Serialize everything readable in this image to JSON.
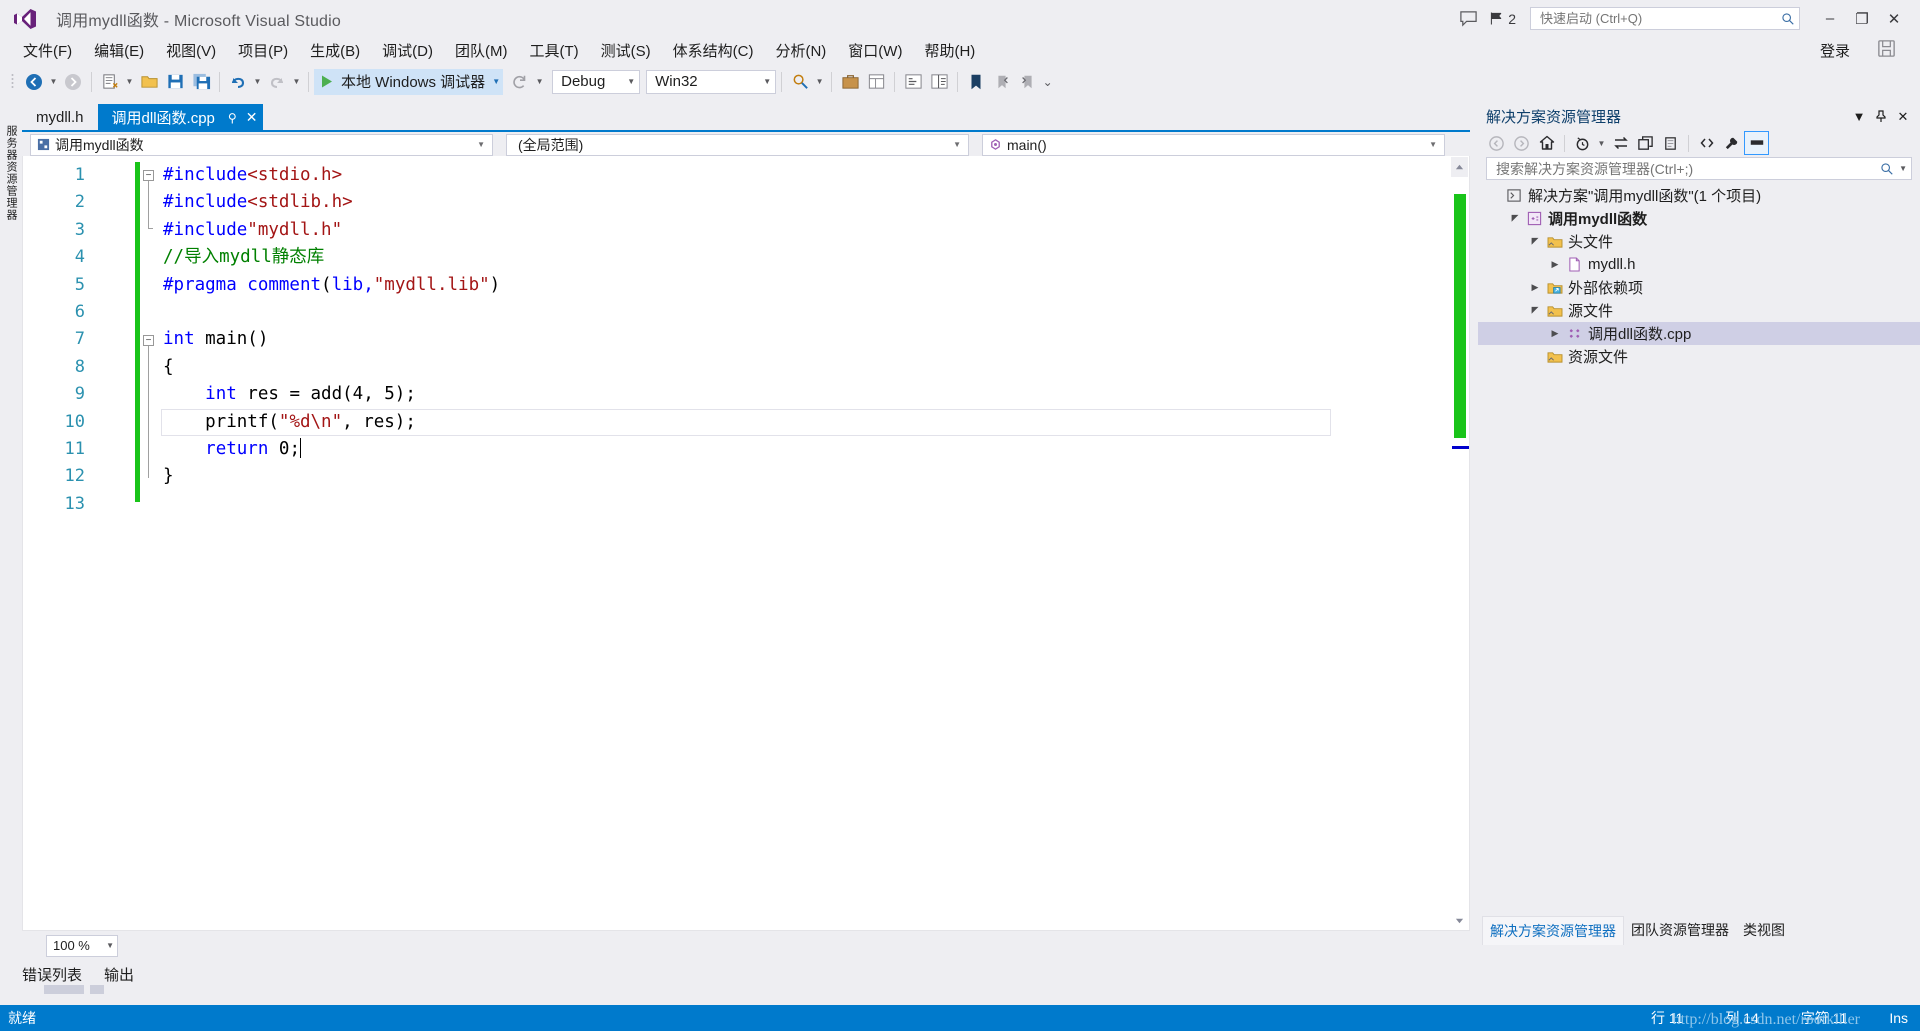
{
  "window": {
    "title": "调用mydll函数 - Microsoft Visual Studio",
    "logo_icon": "visual-studio-logo",
    "minimize_label": "–",
    "maximize_label": "❐",
    "close_label": "✕",
    "signin_label": "登录",
    "notification_count": "2",
    "feedback_icon": "feedback-icon",
    "notification_icon": "notification-flag-icon",
    "save_cloud_icon": "save-cloud-icon"
  },
  "quick_launch": {
    "placeholder": "快速启动 (Ctrl+Q)",
    "value": "",
    "icon": "search-icon"
  },
  "menu": {
    "items": [
      {
        "label": "文件(F)"
      },
      {
        "label": "编辑(E)"
      },
      {
        "label": "视图(V)"
      },
      {
        "label": "项目(P)"
      },
      {
        "label": "生成(B)"
      },
      {
        "label": "调试(D)"
      },
      {
        "label": "团队(M)"
      },
      {
        "label": "工具(T)"
      },
      {
        "label": "测试(S)"
      },
      {
        "label": "体系结构(C)"
      },
      {
        "label": "分析(N)"
      },
      {
        "label": "窗口(W)"
      },
      {
        "label": "帮助(H)"
      }
    ]
  },
  "toolbar": {
    "back_icon": "navigate-back-icon",
    "forward_icon": "navigate-forward-icon",
    "new_project_icon": "new-project-icon",
    "open_file_icon": "open-file-icon",
    "save_icon": "save-icon",
    "save_all_icon": "save-all-icon",
    "undo_icon": "undo-icon",
    "redo_icon": "redo-icon",
    "start_label": "本地 Windows 调试器",
    "start_icon": "play-icon",
    "refresh_icon": "refresh-icon",
    "config_value": "Debug",
    "platform_value": "Win32",
    "find_icon": "find-in-files-icon",
    "step_icons": [
      "toolbox-icon",
      "properties-icon",
      "class-view-icon",
      "object-browser-icon",
      "bookmark-icon",
      "prev-bookmark-icon",
      "next-bookmark-icon"
    ]
  },
  "left_rail": {
    "label": "服务器资源管理器"
  },
  "editor": {
    "tabs": [
      {
        "label": "mydll.h",
        "active": false
      },
      {
        "label": "调用dll函数.cpp",
        "active": true,
        "pin_icon": "pin-icon",
        "close_icon": "close-icon"
      }
    ],
    "navbar": {
      "project_icon": "project-icon",
      "project": "调用mydll函数",
      "scope": "(全局范围)",
      "member_icon": "method-icon",
      "member": "main()"
    },
    "zoom_level": "100 %",
    "line_numbers": [
      "1",
      "2",
      "3",
      "4",
      "5",
      "6",
      "7",
      "8",
      "9",
      "10",
      "11",
      "12",
      "13"
    ],
    "code_lines": [
      {
        "n": 1,
        "tokens": [
          {
            "t": "#include",
            "c": "pp"
          },
          {
            "t": "<stdio.h>",
            "c": "str"
          }
        ]
      },
      {
        "n": 2,
        "tokens": [
          {
            "t": "#include",
            "c": "pp"
          },
          {
            "t": "<stdlib.h>",
            "c": "str"
          }
        ]
      },
      {
        "n": 3,
        "tokens": [
          {
            "t": "#include",
            "c": "pp"
          },
          {
            "t": "\"mydll.h\"",
            "c": "str"
          }
        ]
      },
      {
        "n": 4,
        "tokens": [
          {
            "t": "//导入mydll静态库",
            "c": "cmt"
          }
        ]
      },
      {
        "n": 5,
        "tokens": [
          {
            "t": "#pragma comment",
            "c": "pp"
          },
          {
            "t": "(",
            "c": "plain"
          },
          {
            "t": "lib,",
            "c": "pp"
          },
          {
            "t": "\"mydll.lib\"",
            "c": "str"
          },
          {
            "t": ")",
            "c": "plain"
          }
        ]
      },
      {
        "n": 6,
        "tokens": []
      },
      {
        "n": 7,
        "tokens": [
          {
            "t": "int",
            "c": "kw"
          },
          {
            "t": " main()",
            "c": "plain"
          }
        ]
      },
      {
        "n": 8,
        "tokens": [
          {
            "t": "{",
            "c": "plain"
          }
        ]
      },
      {
        "n": 9,
        "tokens": [
          {
            "t": "    ",
            "c": "plain"
          },
          {
            "t": "int",
            "c": "kw"
          },
          {
            "t": " res = add(4, 5);",
            "c": "plain"
          }
        ]
      },
      {
        "n": 10,
        "tokens": [
          {
            "t": "    printf(",
            "c": "plain"
          },
          {
            "t": "\"%d\\n\"",
            "c": "str"
          },
          {
            "t": ", res);",
            "c": "plain"
          }
        ]
      },
      {
        "n": 11,
        "tokens": [
          {
            "t": "    ",
            "c": "plain"
          },
          {
            "t": "return",
            "c": "kw"
          },
          {
            "t": " 0;",
            "c": "plain"
          }
        ]
      },
      {
        "n": 12,
        "tokens": [
          {
            "t": "}",
            "c": "plain"
          }
        ]
      },
      {
        "n": 13,
        "tokens": []
      }
    ]
  },
  "bottom_panel": {
    "tabs": [
      {
        "label": "错误列表"
      },
      {
        "label": "输出"
      }
    ]
  },
  "solution_explorer": {
    "title": "解决方案资源管理器",
    "dropdown_icon": "chevron-down-icon",
    "pin_icon": "pin-icon",
    "close_icon": "close-icon",
    "toolbar_icons": [
      "back-icon",
      "forward-icon",
      "home-icon",
      "pending-changes-icon",
      "sync-with-active-document-icon",
      "refresh-icon",
      "collapse-all-icon",
      "show-all-files-icon",
      "properties-icon",
      "preview-selected-items-icon"
    ],
    "search": {
      "placeholder": "搜索解决方案资源管理器(Ctrl+;)",
      "value": "",
      "icon": "search-icon"
    },
    "tree": [
      {
        "indent": 0,
        "twisty": "",
        "icon": "solution-icon",
        "label": "解决方案\"调用mydll函数\"(1 个项目)",
        "bold": false,
        "selected": false
      },
      {
        "indent": 1,
        "twisty": "▲",
        "icon": "cpp-project-icon",
        "label": "调用mydll函数",
        "bold": true,
        "selected": false
      },
      {
        "indent": 2,
        "twisty": "▲",
        "icon": "filter-folder-icon",
        "label": "头文件",
        "bold": false,
        "selected": false
      },
      {
        "indent": 3,
        "twisty": "▶",
        "icon": "header-file-icon",
        "label": "mydll.h",
        "bold": false,
        "selected": false
      },
      {
        "indent": 2,
        "twisty": "▶",
        "icon": "external-deps-icon",
        "label": "外部依赖项",
        "bold": false,
        "selected": false
      },
      {
        "indent": 2,
        "twisty": "▲",
        "icon": "filter-folder-icon",
        "label": "源文件",
        "bold": false,
        "selected": false
      },
      {
        "indent": 3,
        "twisty": "▶",
        "icon": "cpp-file-icon",
        "label": "调用dll函数.cpp",
        "bold": false,
        "selected": true
      },
      {
        "indent": 2,
        "twisty": "",
        "icon": "filter-folder-icon",
        "label": "资源文件",
        "bold": false,
        "selected": false
      }
    ],
    "bottom_tabs": [
      {
        "label": "解决方案资源管理器",
        "active": true
      },
      {
        "label": "团队资源管理器",
        "active": false
      },
      {
        "label": "类视图",
        "active": false
      }
    ]
  },
  "status_bar": {
    "state": "就绪",
    "line": "行 11",
    "column": "列 14",
    "character": "字符 11",
    "insert_mode": "Ins",
    "watermark": "http://blog.csdn.net/rootkiller"
  },
  "colors": {
    "accent": "#007acc",
    "tab_active_bg": "#007acc",
    "chrome_bg": "#eeeef2",
    "changebar_green": "#19c419",
    "selection_bg": "#cfcfe5",
    "keyword_blue": "#0000ff",
    "string_red": "#a31515",
    "comment_green": "#008000",
    "linenum_blue": "#2b91af"
  }
}
